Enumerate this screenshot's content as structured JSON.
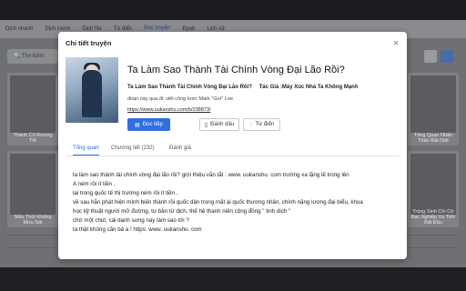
{
  "nav": {
    "items": [
      "Dịch nhanh",
      "Dịch lượm",
      "Dịch file",
      "Từ điển",
      "Đọc truyện",
      "Epub",
      "Lịch sử"
    ],
    "active_index": 4
  },
  "background": {
    "search_placeholder": "Tìm kiếm",
    "cards": [
      {
        "caption": "Thành Cổ Rương Tốt"
      },
      {
        "caption": "Siêu Thời Không Mưu Sát"
      },
      {
        "caption": "Tổng Quan Nhân Thần Bất Diệt"
      },
      {
        "caption": "Trùng Sinh Chi Cờ Bạc Nghiệp Vụ Tiên Bất Đầu"
      }
    ]
  },
  "modal": {
    "title": "Chi tiết truyện",
    "close_icon": "close-icon",
    "book": {
      "title": "Ta Làm Sao Thành Tài Chính Vòng Đại Lão Rồi?",
      "title_vi": "Ta Làm Sao Thành Tài Chính Vòng Đại Lão Rồi?",
      "author": "Tác Giả :Máy Xúc Nhà Ta Không Mạnh",
      "subtitle": "đoạn này qua đi, viết công lược Mark \"Gor\" Lee",
      "link": "https://www.uukanshu.com/b/238873/"
    },
    "buttons": {
      "read": "Đọc tiếp",
      "bookmark": "Đánh dấu",
      "comment": "Từ điển"
    },
    "tabs": [
      "Tổng quan",
      "Chương tiết (232)",
      "Đánh giá"
    ],
    "active_tab": 0,
    "description": [
      "ta làm sao thành tài chính vòng đại lão rồi?   giới thiệu vắn tắt : www. uukanshu. com            trường xa lặng lẽ trong lên",
      "A ném rồi ít tiền .",
      "lại trong quốc tế thị trường ném rồi ít tiền .",
      "về sau hắn phát hiện mình biến thành rồi quốc dân trong mất ái quốc thương nhân, chính năng lượng đại biểu, khoa",
      "học kỹ thuật người mở đường, tư bản từ dịch, thế hệ thanh niên cộng đồng \" tinh dịch \"",
      "chờ một chút, cái danh sưng này làm sao tới ?",
      "ta thật không cần bả a !   https: www. uukanshu. com"
    ]
  }
}
